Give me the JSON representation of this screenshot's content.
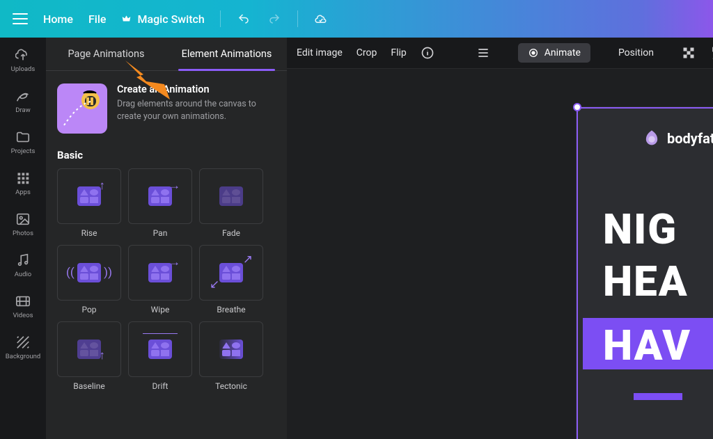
{
  "topbar": {
    "home": "Home",
    "file": "File",
    "magic": "Magic Switch"
  },
  "leftnav": [
    {
      "key": "uploads",
      "label": "Uploads"
    },
    {
      "key": "draw",
      "label": "Draw"
    },
    {
      "key": "projects",
      "label": "Projects"
    },
    {
      "key": "apps",
      "label": "Apps"
    },
    {
      "key": "photos",
      "label": "Photos"
    },
    {
      "key": "audio",
      "label": "Audio"
    },
    {
      "key": "videos",
      "label": "Videos"
    },
    {
      "key": "background",
      "label": "Background"
    }
  ],
  "panel": {
    "tabs": {
      "page": "Page Animations",
      "element": "Element Animations",
      "active": "element"
    },
    "create": {
      "title": "Create an Animation",
      "sub": "Drag elements around the canvas to create your own animations."
    },
    "section": "Basic",
    "animations": [
      {
        "key": "rise",
        "label": "Rise"
      },
      {
        "key": "pan",
        "label": "Pan"
      },
      {
        "key": "fade",
        "label": "Fade"
      },
      {
        "key": "pop",
        "label": "Pop"
      },
      {
        "key": "wipe",
        "label": "Wipe"
      },
      {
        "key": "breathe",
        "label": "Breathe"
      },
      {
        "key": "baseline",
        "label": "Baseline"
      },
      {
        "key": "drift",
        "label": "Drift"
      },
      {
        "key": "tectonic",
        "label": "Tectonic"
      }
    ]
  },
  "context": {
    "edit_image": "Edit image",
    "crop": "Crop",
    "flip": "Flip",
    "animate": "Animate",
    "position": "Position"
  },
  "design": {
    "brand": "bodyfatcutter.",
    "line1": "NIG",
    "line2": "HEA",
    "line3": "HAV"
  }
}
